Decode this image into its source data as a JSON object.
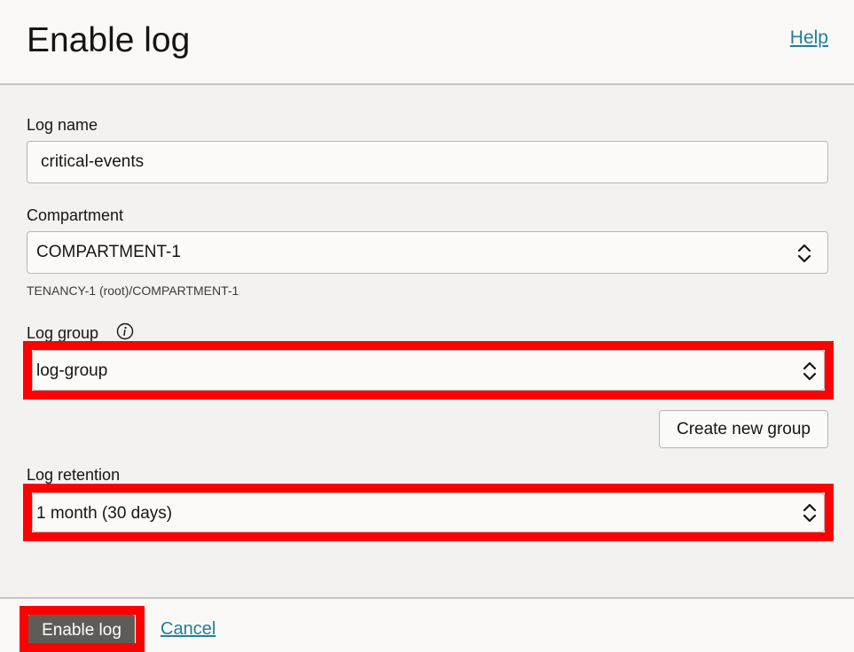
{
  "header": {
    "title": "Enable log",
    "help_label": "Help"
  },
  "form": {
    "log_name": {
      "label": "Log name",
      "value": "critical-events"
    },
    "compartment": {
      "label": "Compartment",
      "value": "COMPARTMENT-1",
      "hint": "TENANCY-1 (root)/COMPARTMENT-1"
    },
    "log_group": {
      "label": "Log group",
      "value": "log-group",
      "create_button_label": "Create new group"
    },
    "log_retention": {
      "label": "Log retention",
      "value": "1 month (30 days)"
    }
  },
  "footer": {
    "enable_label": "Enable log",
    "cancel_label": "Cancel"
  },
  "icons": {
    "info": "info-icon",
    "select": "chevron-up-down-icon"
  },
  "colors": {
    "highlight": "#fe0000",
    "link": "#227e9e",
    "primary_button": "#5f5c58",
    "background": "#f3f2f1"
  }
}
